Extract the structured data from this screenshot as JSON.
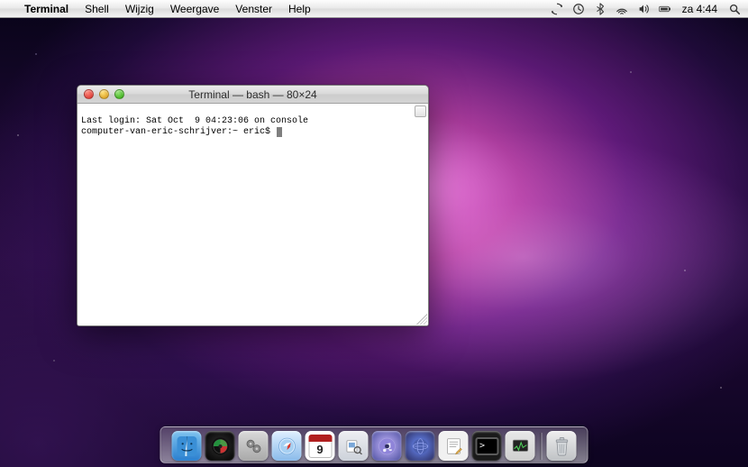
{
  "menubar": {
    "app_name": "Terminal",
    "items": [
      "Shell",
      "Wijzig",
      "Weergave",
      "Venster",
      "Help"
    ],
    "clock": "za 4:44"
  },
  "window": {
    "title": "Terminal — bash — 80×24",
    "last_login_line": "Last login: Sat Oct  9 04:23:06 on console",
    "prompt_line": "computer-van-eric-schrijver:~ eric$ "
  },
  "dock": {
    "items": [
      {
        "name": "finder"
      },
      {
        "name": "dashboard"
      },
      {
        "name": "system-preferences"
      },
      {
        "name": "safari"
      },
      {
        "name": "ical",
        "day": "9"
      },
      {
        "name": "preview"
      },
      {
        "name": "itunes"
      },
      {
        "name": "network-utility"
      },
      {
        "name": "textedit"
      },
      {
        "name": "terminal"
      },
      {
        "name": "activity-monitor"
      }
    ],
    "trash": {
      "name": "trash"
    }
  }
}
